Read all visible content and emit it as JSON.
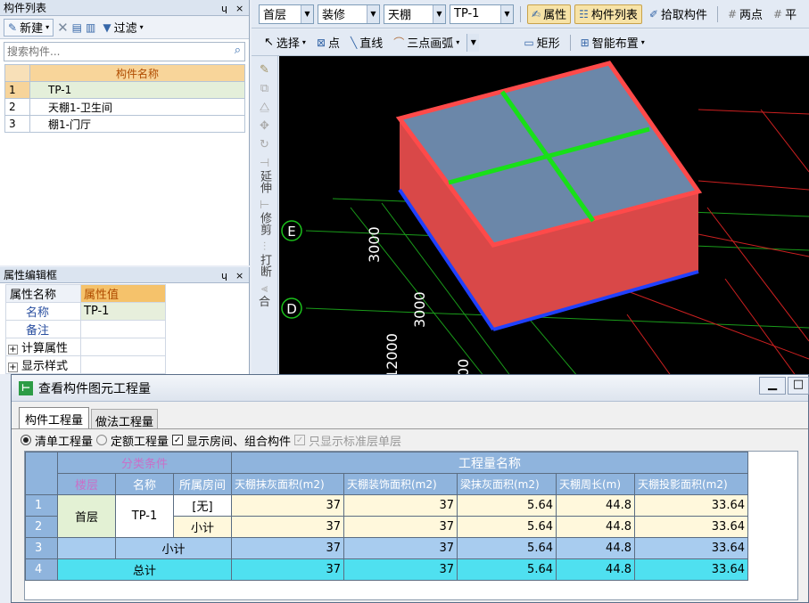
{
  "left_panel": {
    "title": "构件列表",
    "toolbar": {
      "new_label": "新建"
    },
    "filter_label": "过滤",
    "search_placeholder": "搜索构件...",
    "table_header": "构件名称",
    "rows": [
      {
        "num": "1",
        "name": "TP-1"
      },
      {
        "num": "2",
        "name": "天棚1-卫生间"
      },
      {
        "num": "3",
        "name": "棚1-门厅"
      }
    ]
  },
  "prop_panel": {
    "title": "属性编辑框",
    "header_name": "属性名称",
    "header_value": "属性值",
    "rows": [
      {
        "name": "名称",
        "value": "TP-1"
      },
      {
        "name": "备注",
        "value": ""
      },
      {
        "name": "计算属性",
        "value": "",
        "expand": "+"
      },
      {
        "name": "显示样式",
        "value": "",
        "expand": "+"
      }
    ]
  },
  "toolbar1": {
    "floor": "首层",
    "category": "装修",
    "type": "天棚",
    "component": "TP-1",
    "properties": "属性",
    "comp_list": "构件列表",
    "pick": "拾取构件",
    "two_point": "两点",
    "parallel": "平"
  },
  "toolbar2": {
    "select": "选择",
    "point": "点",
    "line": "直线",
    "arc": "三点画弧",
    "rect": "矩形",
    "smart": "智能布置"
  },
  "vtools": {
    "extend": "延伸",
    "trim": "修剪",
    "break": "打断",
    "merge": "合"
  },
  "canvas": {
    "axis_e": "E",
    "axis_d": "D",
    "dims": [
      "3000",
      "3000",
      "12000",
      "00"
    ]
  },
  "dialog": {
    "title": "查看构件图元工程量",
    "tabs": [
      "构件工程量",
      "做法工程量"
    ],
    "opt_list": "清单工程量",
    "opt_quota": "定额工程量",
    "opt_show_rooms": "显示房间、组合构件",
    "opt_standard": "只显示标准层单层",
    "group_category": "分类条件",
    "group_quantity": "工程量名称",
    "col_floor": "楼层",
    "col_name": "名称",
    "col_room": "所属房间",
    "qty_cols": [
      "天棚抹灰面积(m2)",
      "天棚装饰面积(m2)",
      "梁抹灰面积(m2)",
      "天棚周长(m)",
      "天棚投影面积(m2)"
    ],
    "rows": [
      {
        "num": "1",
        "room": "[无]",
        "vals": [
          "37",
          "37",
          "5.64",
          "44.8",
          "33.64"
        ]
      },
      {
        "num": "2",
        "room": "小计",
        "vals": [
          "37",
          "37",
          "5.64",
          "44.8",
          "33.64"
        ]
      },
      {
        "num": "3",
        "label": "小计",
        "vals": [
          "37",
          "37",
          "5.64",
          "44.8",
          "33.64"
        ]
      },
      {
        "num": "4",
        "label": "总计",
        "vals": [
          "37",
          "37",
          "5.64",
          "44.8",
          "33.64"
        ]
      }
    ],
    "floor_value": "首层",
    "name_value": "TP-1"
  },
  "colors": {
    "canvas_bg": "#000000",
    "box_wall": "#e04848",
    "box_top": "#6b87a9",
    "grid_green": "#00c000",
    "header_orange": "#f5c26b",
    "table_blue": "#8fb4dd",
    "total_cyan": "#4fe0f0"
  }
}
